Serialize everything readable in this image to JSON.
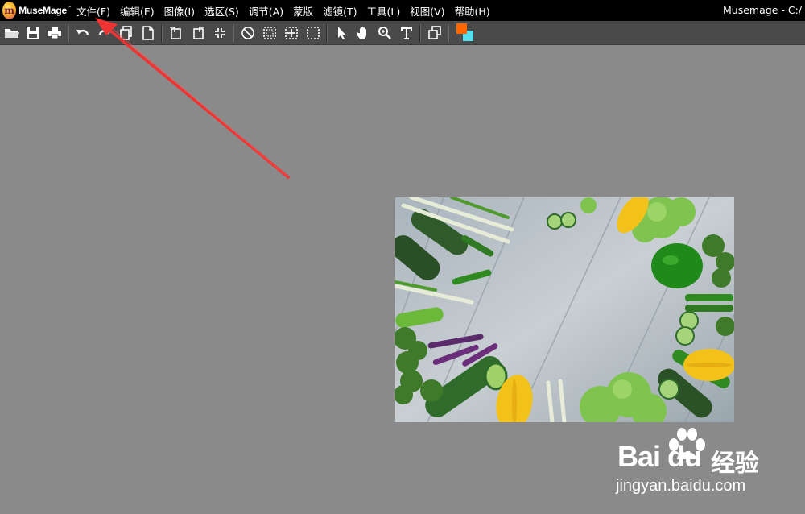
{
  "app": {
    "logo_text": "MuseMage",
    "logo_letter": "m",
    "window_title": "Musemage - C:/"
  },
  "menu": [
    {
      "label": "文件(F)"
    },
    {
      "label": "编辑(E)"
    },
    {
      "label": "图像(I)"
    },
    {
      "label": "选区(S)"
    },
    {
      "label": "调节(A)"
    },
    {
      "label": "蒙版"
    },
    {
      "label": "滤镜(T)"
    },
    {
      "label": "工具(L)"
    },
    {
      "label": "视图(V)"
    },
    {
      "label": "帮助(H)"
    }
  ],
  "toolbar": {
    "icons": [
      "open-folder-icon",
      "save-icon",
      "print-icon",
      "undo-icon",
      "redo-icon",
      "copy-icon",
      "paste-icon",
      "rotate-left-icon",
      "rotate-right-icon",
      "fit-icon",
      "deselect-icon",
      "select-all-icon",
      "select-move-icon",
      "marquee-icon",
      "pointer-icon",
      "hand-icon",
      "zoom-icon",
      "text-icon",
      "layers-icon"
    ],
    "foreground_color": "#ff6600",
    "background_color": "#55e0f0"
  },
  "colors": {
    "menubar": "#000000",
    "toolbar": "#4a4a4a",
    "canvas": "#8a8a8a",
    "annotation_arrow": "#ee3333"
  },
  "watermark": {
    "logo": "Bai du",
    "brand_cn": "经验",
    "url": "jingyan.baidu.com"
  }
}
